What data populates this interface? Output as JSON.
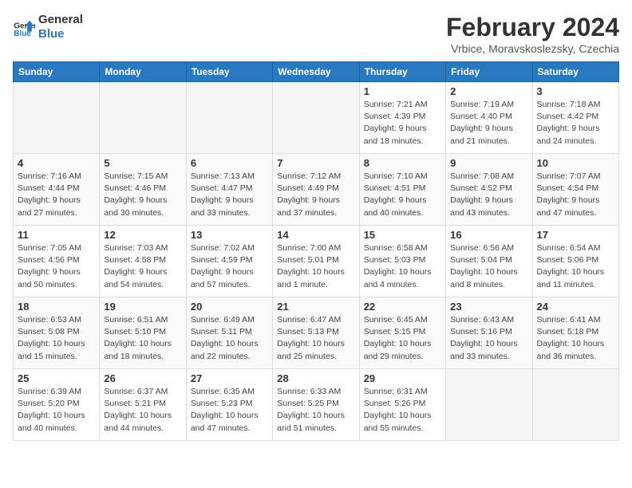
{
  "logo": {
    "line1": "General",
    "line2": "Blue"
  },
  "title": "February 2024",
  "subtitle": "Vrbice, Moravskoslezsky, Czechia",
  "days_of_week": [
    "Sunday",
    "Monday",
    "Tuesday",
    "Wednesday",
    "Thursday",
    "Friday",
    "Saturday"
  ],
  "weeks": [
    [
      {
        "day": "",
        "info": ""
      },
      {
        "day": "",
        "info": ""
      },
      {
        "day": "",
        "info": ""
      },
      {
        "day": "",
        "info": ""
      },
      {
        "day": "1",
        "info": "Sunrise: 7:21 AM\nSunset: 4:39 PM\nDaylight: 9 hours\nand 18 minutes."
      },
      {
        "day": "2",
        "info": "Sunrise: 7:19 AM\nSunset: 4:40 PM\nDaylight: 9 hours\nand 21 minutes."
      },
      {
        "day": "3",
        "info": "Sunrise: 7:18 AM\nSunset: 4:42 PM\nDaylight: 9 hours\nand 24 minutes."
      }
    ],
    [
      {
        "day": "4",
        "info": "Sunrise: 7:16 AM\nSunset: 4:44 PM\nDaylight: 9 hours\nand 27 minutes."
      },
      {
        "day": "5",
        "info": "Sunrise: 7:15 AM\nSunset: 4:46 PM\nDaylight: 9 hours\nand 30 minutes."
      },
      {
        "day": "6",
        "info": "Sunrise: 7:13 AM\nSunset: 4:47 PM\nDaylight: 9 hours\nand 33 minutes."
      },
      {
        "day": "7",
        "info": "Sunrise: 7:12 AM\nSunset: 4:49 PM\nDaylight: 9 hours\nand 37 minutes."
      },
      {
        "day": "8",
        "info": "Sunrise: 7:10 AM\nSunset: 4:51 PM\nDaylight: 9 hours\nand 40 minutes."
      },
      {
        "day": "9",
        "info": "Sunrise: 7:08 AM\nSunset: 4:52 PM\nDaylight: 9 hours\nand 43 minutes."
      },
      {
        "day": "10",
        "info": "Sunrise: 7:07 AM\nSunset: 4:54 PM\nDaylight: 9 hours\nand 47 minutes."
      }
    ],
    [
      {
        "day": "11",
        "info": "Sunrise: 7:05 AM\nSunset: 4:56 PM\nDaylight: 9 hours\nand 50 minutes."
      },
      {
        "day": "12",
        "info": "Sunrise: 7:03 AM\nSunset: 4:58 PM\nDaylight: 9 hours\nand 54 minutes."
      },
      {
        "day": "13",
        "info": "Sunrise: 7:02 AM\nSunset: 4:59 PM\nDaylight: 9 hours\nand 57 minutes."
      },
      {
        "day": "14",
        "info": "Sunrise: 7:00 AM\nSunset: 5:01 PM\nDaylight: 10 hours\nand 1 minute."
      },
      {
        "day": "15",
        "info": "Sunrise: 6:58 AM\nSunset: 5:03 PM\nDaylight: 10 hours\nand 4 minutes."
      },
      {
        "day": "16",
        "info": "Sunrise: 6:56 AM\nSunset: 5:04 PM\nDaylight: 10 hours\nand 8 minutes."
      },
      {
        "day": "17",
        "info": "Sunrise: 6:54 AM\nSunset: 5:06 PM\nDaylight: 10 hours\nand 11 minutes."
      }
    ],
    [
      {
        "day": "18",
        "info": "Sunrise: 6:53 AM\nSunset: 5:08 PM\nDaylight: 10 hours\nand 15 minutes."
      },
      {
        "day": "19",
        "info": "Sunrise: 6:51 AM\nSunset: 5:10 PM\nDaylight: 10 hours\nand 18 minutes."
      },
      {
        "day": "20",
        "info": "Sunrise: 6:49 AM\nSunset: 5:11 PM\nDaylight: 10 hours\nand 22 minutes."
      },
      {
        "day": "21",
        "info": "Sunrise: 6:47 AM\nSunset: 5:13 PM\nDaylight: 10 hours\nand 25 minutes."
      },
      {
        "day": "22",
        "info": "Sunrise: 6:45 AM\nSunset: 5:15 PM\nDaylight: 10 hours\nand 29 minutes."
      },
      {
        "day": "23",
        "info": "Sunrise: 6:43 AM\nSunset: 5:16 PM\nDaylight: 10 hours\nand 33 minutes."
      },
      {
        "day": "24",
        "info": "Sunrise: 6:41 AM\nSunset: 5:18 PM\nDaylight: 10 hours\nand 36 minutes."
      }
    ],
    [
      {
        "day": "25",
        "info": "Sunrise: 6:39 AM\nSunset: 5:20 PM\nDaylight: 10 hours\nand 40 minutes."
      },
      {
        "day": "26",
        "info": "Sunrise: 6:37 AM\nSunset: 5:21 PM\nDaylight: 10 hours\nand 44 minutes."
      },
      {
        "day": "27",
        "info": "Sunrise: 6:35 AM\nSunset: 5:23 PM\nDaylight: 10 hours\nand 47 minutes."
      },
      {
        "day": "28",
        "info": "Sunrise: 6:33 AM\nSunset: 5:25 PM\nDaylight: 10 hours\nand 51 minutes."
      },
      {
        "day": "29",
        "info": "Sunrise: 6:31 AM\nSunset: 5:26 PM\nDaylight: 10 hours\nand 55 minutes."
      },
      {
        "day": "",
        "info": ""
      },
      {
        "day": "",
        "info": ""
      }
    ]
  ]
}
